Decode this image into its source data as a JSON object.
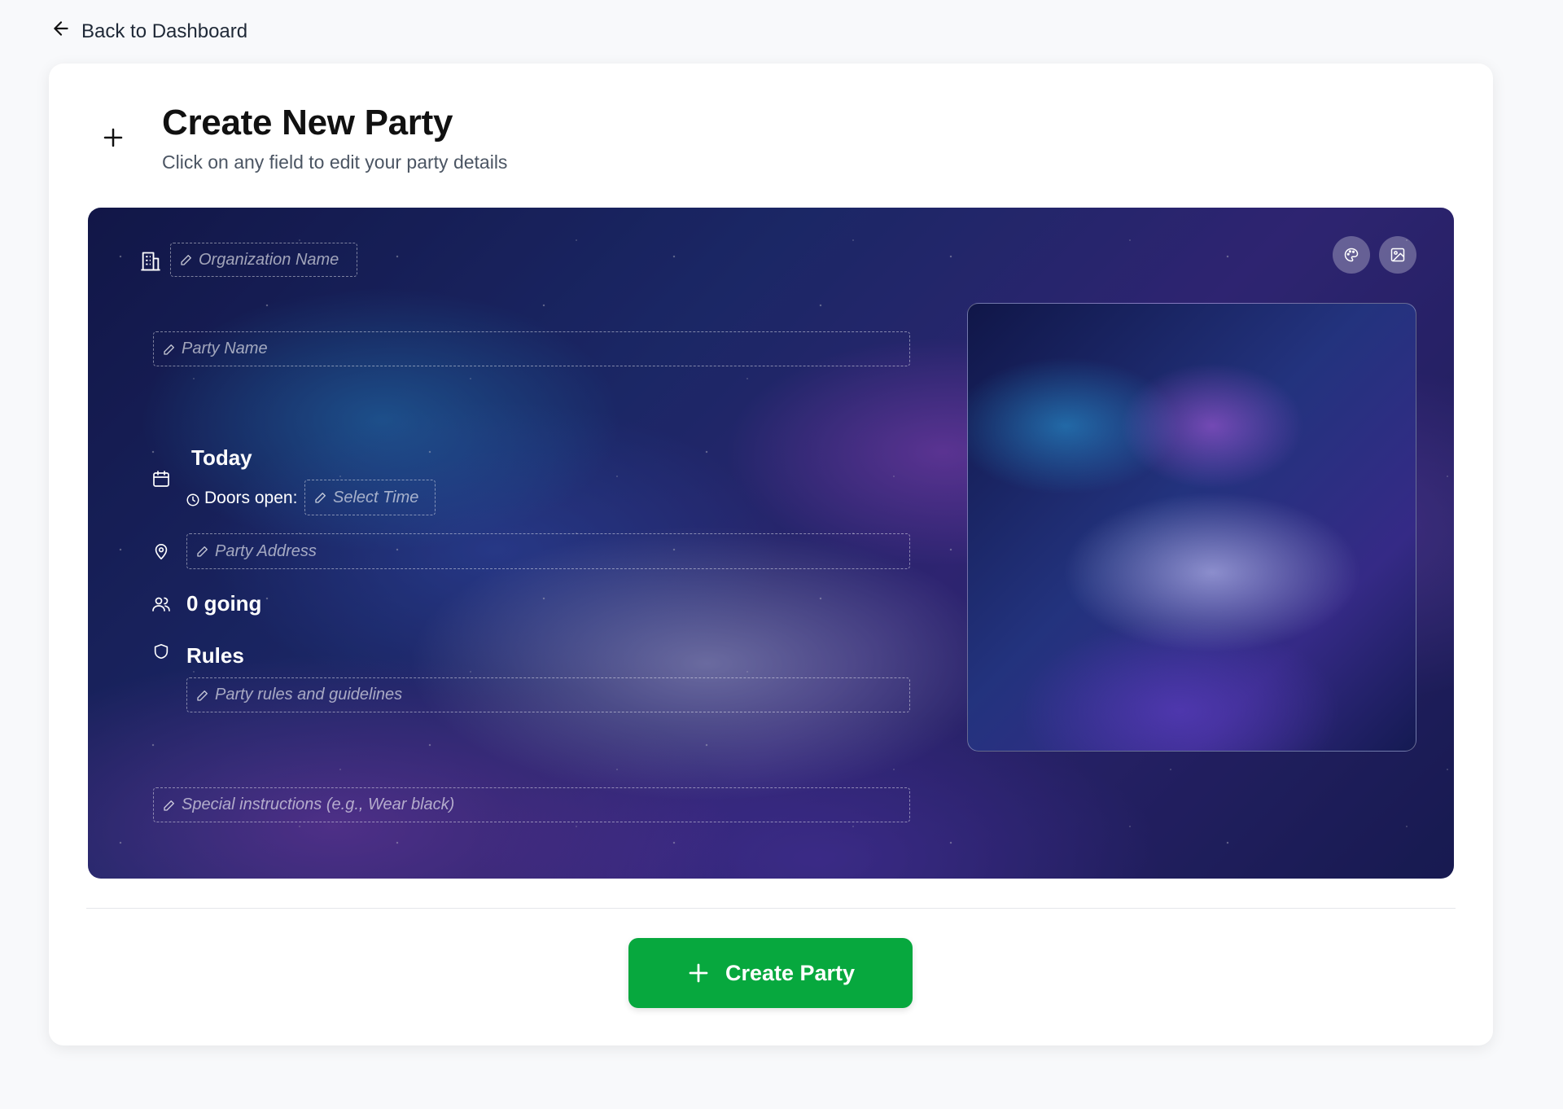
{
  "nav": {
    "back_label": "Back to Dashboard"
  },
  "header": {
    "title": "Create New Party",
    "subtitle": "Click on any field to edit your party details"
  },
  "party": {
    "organization_placeholder": "Organization Name",
    "name_placeholder": "Party Name",
    "date_label": "Today",
    "doors_open_label": "Doors open:",
    "time_placeholder": "Select Time",
    "address_placeholder": "Party Address",
    "going_label": "0 going",
    "rules_label": "Rules",
    "rules_placeholder": "Party rules and guidelines",
    "instructions_placeholder": "Special instructions (e.g., Wear black)"
  },
  "actions": {
    "create_label": "Create Party"
  },
  "colors": {
    "accent": "#07a83e",
    "background": "#f8f9fb",
    "card": "#ffffff"
  }
}
